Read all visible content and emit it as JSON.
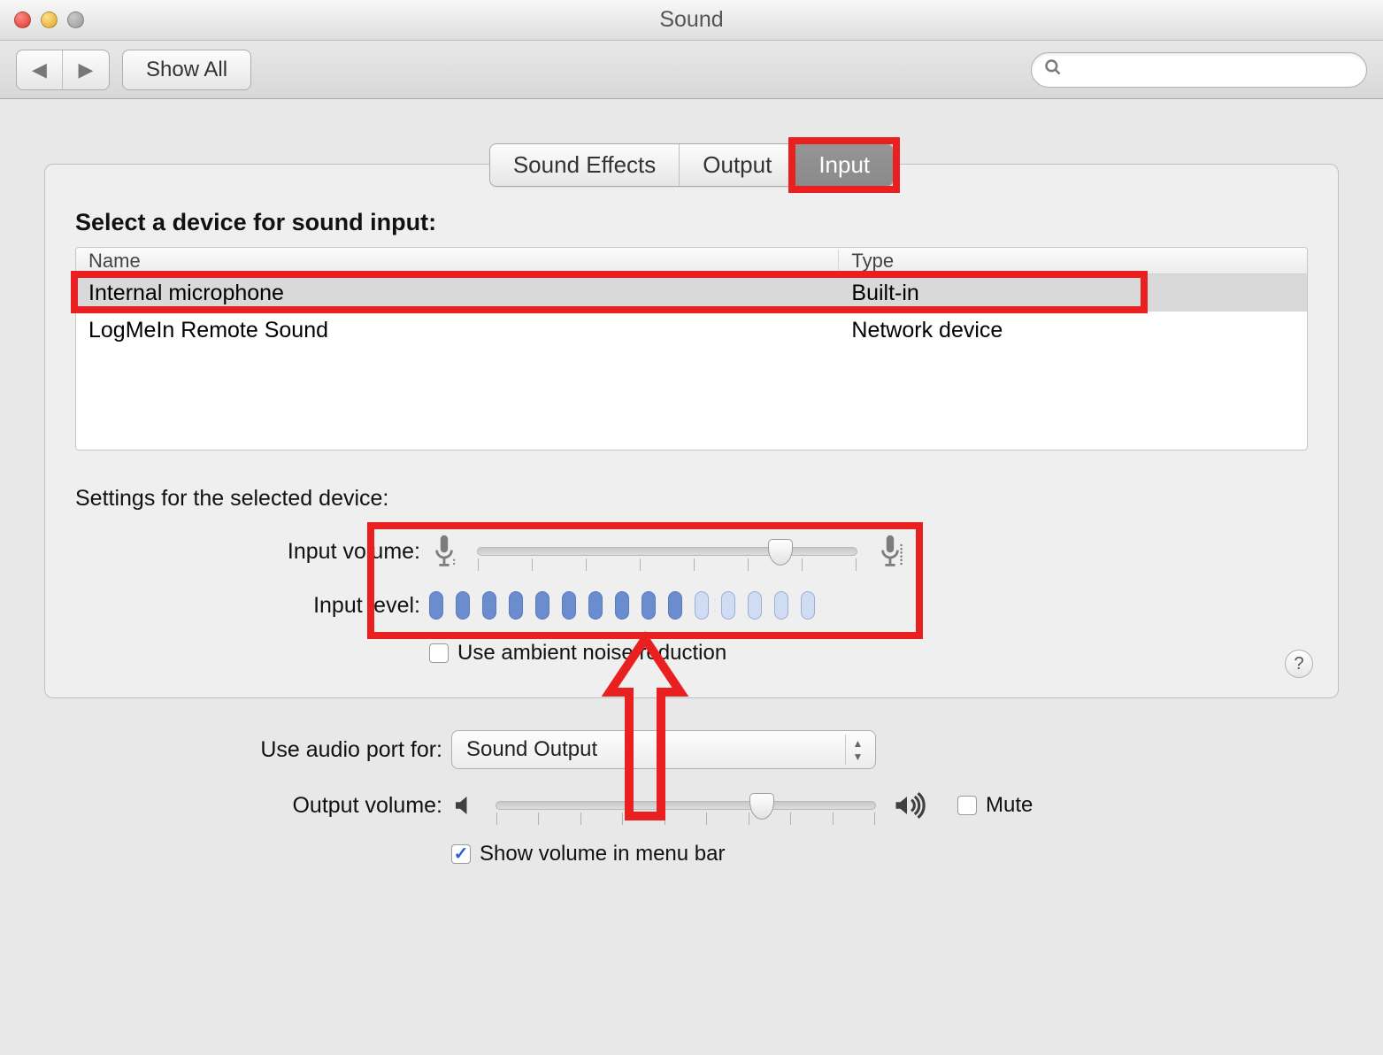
{
  "window": {
    "title": "Sound"
  },
  "toolbar": {
    "showall_label": "Show All",
    "search_placeholder": ""
  },
  "tabs": [
    {
      "label": "Sound Effects",
      "active": false
    },
    {
      "label": "Output",
      "active": false
    },
    {
      "label": "Input",
      "active": true
    }
  ],
  "section": {
    "select_heading": "Select a device for sound input:",
    "columns": {
      "name": "Name",
      "type": "Type"
    },
    "devices": [
      {
        "name": "Internal microphone",
        "type": "Built-in",
        "selected": true
      },
      {
        "name": "LogMeIn Remote Sound",
        "type": "Network device",
        "selected": false
      }
    ],
    "settings_heading": "Settings for the selected device:",
    "input_volume_label": "Input volume:",
    "input_volume_percent": 80,
    "input_level_label": "Input level:",
    "input_level_segments_total": 15,
    "input_level_segments_lit": 10,
    "ambient_noise_label": "Use ambient noise reduction",
    "ambient_noise_checked": false
  },
  "footer": {
    "audio_port_label": "Use audio port for:",
    "audio_port_value": "Sound Output",
    "output_volume_label": "Output volume:",
    "output_volume_percent": 70,
    "mute_label": "Mute",
    "mute_checked": false,
    "show_in_menubar_label": "Show volume in menu bar",
    "show_in_menubar_checked": true
  },
  "annotations": {
    "highlight_tab_input": true,
    "highlight_selected_device_row": true,
    "highlight_input_sliders_block": true,
    "arrow_points_to_input_block": true
  }
}
